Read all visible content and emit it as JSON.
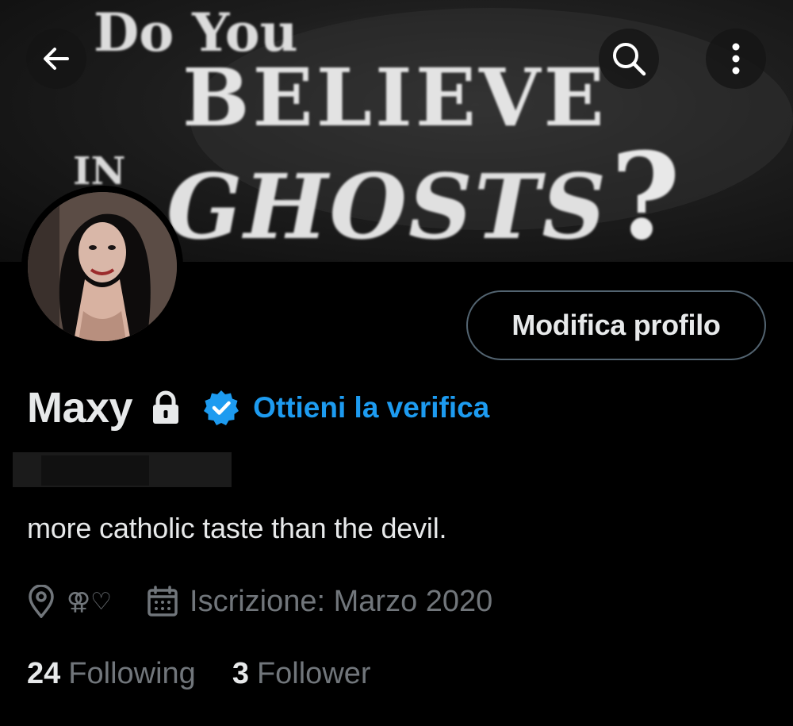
{
  "banner": {
    "line1": "Do You",
    "line2": "BELIEVE",
    "line3_small": "IN",
    "line3": "GHOSTS",
    "mark": "?"
  },
  "header": {
    "back_icon": "arrow-left-icon",
    "search_icon": "search-icon",
    "more_icon": "more-vertical-icon"
  },
  "profile": {
    "edit_label": "Modifica profilo",
    "name": "Maxy",
    "lock_icon": "lock-icon",
    "verify_label": "Ottieni la verifica",
    "verify_icon": "verified-badge-icon",
    "bio": "more catholic taste than the devil.",
    "location": "⚢♡",
    "joined": "Iscrizione: Marzo 2020",
    "following_count": "24",
    "following_label": "Following",
    "followers_count": "3",
    "followers_label": "Follower"
  },
  "colors": {
    "accent": "#1d9bf0",
    "muted": "#71767b",
    "text": "#e7e9ea",
    "border": "#536471"
  }
}
